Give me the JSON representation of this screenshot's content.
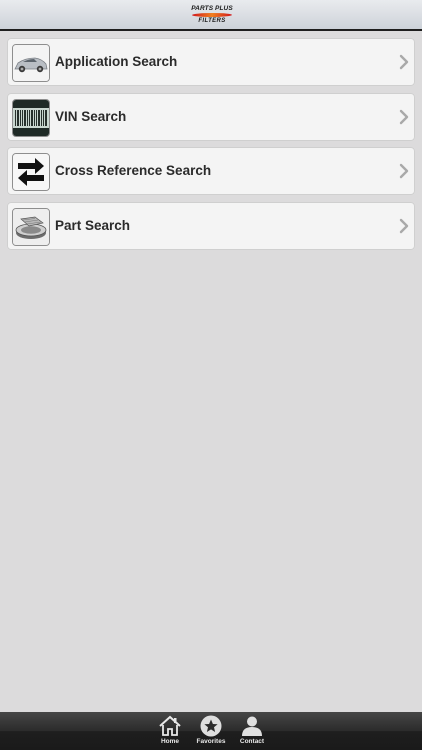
{
  "header": {
    "logo_line1": "PARTS PLUS",
    "logo_line2": "FILTERS"
  },
  "menu": {
    "items": [
      {
        "label": "Application Search",
        "icon": "car-icon"
      },
      {
        "label": "VIN Search",
        "icon": "barcode-icon"
      },
      {
        "label": "Cross Reference Search",
        "icon": "swap-arrows-icon"
      },
      {
        "label": "Part Search",
        "icon": "filter-part-icon"
      }
    ]
  },
  "tabbar": {
    "tabs": [
      {
        "label": "Home",
        "icon": "home-icon"
      },
      {
        "label": "Favorites",
        "icon": "star-icon"
      },
      {
        "label": "Contact",
        "icon": "person-icon"
      }
    ]
  },
  "colors": {
    "background": "#dcdbdc",
    "row_bg": "#f4f4f4",
    "tabbar": "#2b2b2b",
    "logo_red": "#d0161b",
    "logo_orange": "#f07f1f"
  }
}
